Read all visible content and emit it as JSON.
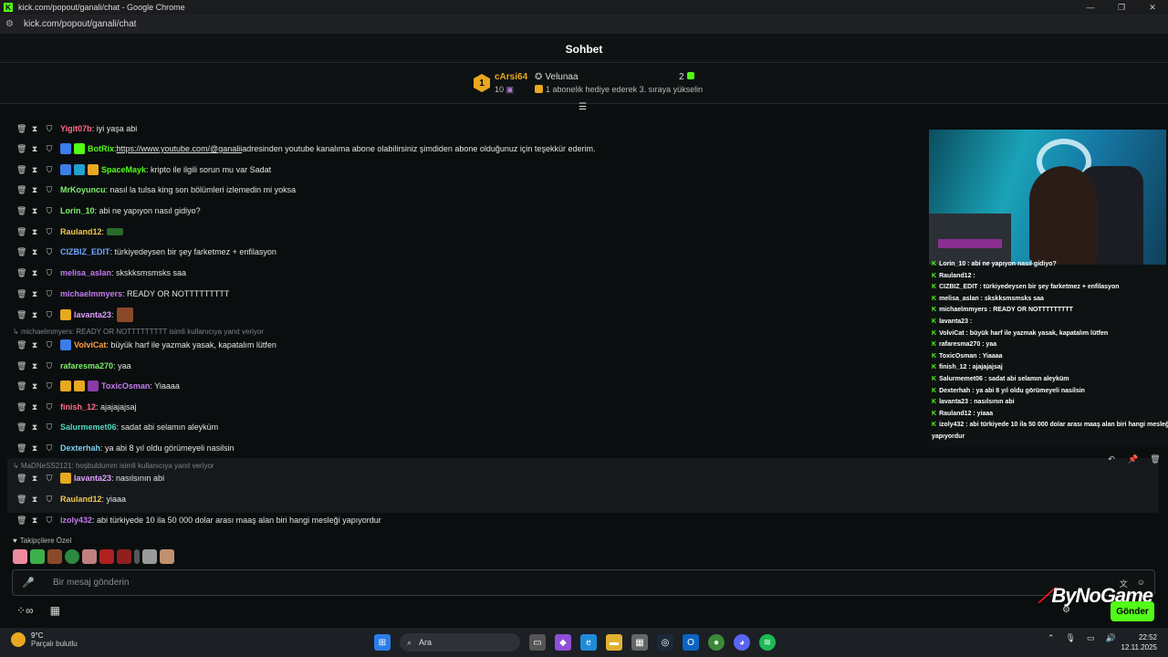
{
  "window": {
    "title": "kick.com/popout/ganali/chat - Google Chrome",
    "url": "kick.com/popout/ganali/chat"
  },
  "chat": {
    "header": "Sohbet"
  },
  "pinned": {
    "rank": "1",
    "gifter_name": "cArsi64",
    "gifter_count": "10",
    "gift_user": "Velunaa",
    "gift_num": "2",
    "gift_desc": "1 abonelik hediye ederek 3. sıraya yükselin"
  },
  "messages": [
    {
      "user": "Yigit07b",
      "color": "#ff6b8b",
      "text": ": iyi yaşa abi"
    },
    {
      "user": "BotRix",
      "color": "#53fc18",
      "text": ": ",
      "link": "https://www.youtube.com/@ganalii",
      "text2": " adresinden youtube kanalıma abone olabilirsiniz şimdiden abone olduğunuz için teşekkür ederim."
    },
    {
      "user": "SpaceMayk",
      "color": "#53fc18",
      "text": ": kripto ile ilgili sorun mu var Sadat"
    },
    {
      "user": "MrKoyuncu",
      "color": "#7cf06a",
      "text": ": nasıl la tulsa king son bölümleri izlemedin mi yoksa"
    },
    {
      "user": "Lorin_10",
      "color": "#7cf06a",
      "text": ": abi ne yapıyon nasıl gidiyo?"
    },
    {
      "user": "Rauland12",
      "color": "#f2c94c",
      "text": ":"
    },
    {
      "user": "CIZBIZ_EDIT",
      "color": "#6fa8ff",
      "text": ": türkiyedeysen bir şey farketmez + enfilasyon"
    },
    {
      "user": "melisa_aslan",
      "color": "#c47cf0",
      "text": ": skskksmsmsks saa"
    },
    {
      "user": "michaelmmyers",
      "color": "#c47cf0",
      "text": ": READY OR NOTTTTTTTTT"
    },
    {
      "user": "lavanta23",
      "color": "#e0a0ff",
      "text": ":"
    },
    {
      "user": "VolviCat",
      "color": "#ff9f40",
      "text": ": büyük harf ile yazmak yasak, kapatalım lütfen"
    },
    {
      "user": "rafaresma270",
      "color": "#7cf06a",
      "text": ": yaa"
    },
    {
      "user": "ToxicOsman",
      "color": "#c47cf0",
      "text": ": Yiaaaa"
    },
    {
      "user": "finish_12",
      "color": "#ff6b8b",
      "text": ": ajajajajsaj"
    },
    {
      "user": "Salurmemet06",
      "color": "#53d6c2",
      "text": ": sadat abi selamın aleyküm"
    },
    {
      "user": "Dexterhah",
      "color": "#7cd0f0",
      "text": ": ya abi 8 yıl oldu görümeyeli nasilsin"
    },
    {
      "user": "lavanta23",
      "color": "#e0a0ff",
      "text": ": nasılsının abi"
    },
    {
      "user": "Rauland12",
      "color": "#f2c94c",
      "text": ": yiaaa"
    },
    {
      "user": "izoly432",
      "color": "#c47cf0",
      "text": ": abi türkiyede 10 ila 50 000 dolar arası maaş alan biri hangi mesleği yapıyordur"
    }
  ],
  "replies": [
    "michaelmmyers: READY OR NOTTTTTTTTT isimli kullanıcıya yanıt veriyor",
    "MaDNeSS2121: hoşbuldumm isimli kullanıcıya yanıt veriyor"
  ],
  "overlay": [
    "Lorin_10 : abi ne yapıyon nasıl gidiyo?",
    "Rauland12 :",
    "CIZBIZ_EDIT : türkiyedeysen bir şey farketmez + enfilasyon",
    "melisa_aslan : skskksmsmsks saa",
    "michaelmmyers : READY OR NOTTTTTTTTT",
    "lavanta23 :",
    "VolviCat : büyük harf ile yazmak yasak, kapatalım lütfen",
    "rafaresma270 : yaa",
    "ToxicOsman : Yiaaaa",
    "finish_12 : ajajajajsaj",
    "Salurmemet06 : sadat abi selamın aleyküm",
    "Dexterhah : ya abi 8 yıl oldu görümeyeli nasilsin",
    "lavanta23 : nasılsının abi",
    "Rauland12 : yiaaa",
    "izoly432 : abi türkiyede 10 ila 50 000 dolar arası maaş alan biri hangi mesleği",
    "yapıyordur"
  ],
  "followers_label": "Takipçilere Özel",
  "input": {
    "placeholder": "Bir mesaj gönderin"
  },
  "send_label": "Gönder",
  "watermark": "ByNoGame",
  "taskbar": {
    "temp": "9°C",
    "weather": "Parçalı bulutlu",
    "search": "Ara",
    "time": "22:52",
    "date": "12.11.2025"
  },
  "colors": {
    "accent": "#53fc18",
    "background": "#0b0e0f",
    "gold": "#e8a820"
  }
}
